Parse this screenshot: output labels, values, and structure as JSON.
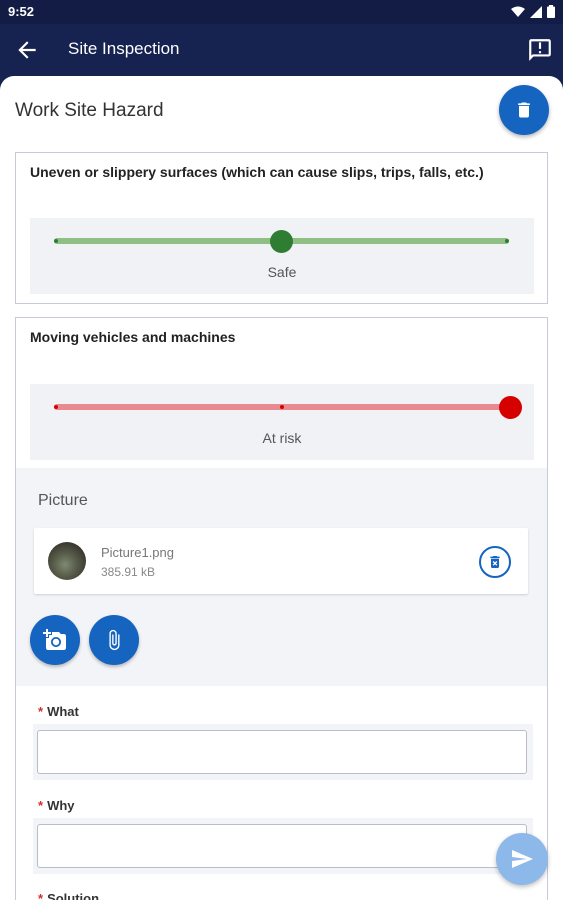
{
  "status_bar": {
    "time": "9:52"
  },
  "app_bar": {
    "title": "Site Inspection"
  },
  "section": {
    "title": "Work Site Hazard"
  },
  "hazards": [
    {
      "label": "Uneven or slippery surfaces (which can cause slips, trips, falls, etc.)",
      "value_label": "Safe",
      "level": 0.5,
      "color": "#8fbf85",
      "thumb_color": "#2e7d32"
    },
    {
      "label": "Moving vehicles and machines",
      "value_label": "At risk",
      "level": 1.0,
      "color": "#e88a8f",
      "thumb_color": "#d50000"
    }
  ],
  "picture": {
    "label": "Picture",
    "file": {
      "name": "Picture1.png",
      "size": "385.91 kB"
    }
  },
  "fields": {
    "what": {
      "label": "What",
      "value": ""
    },
    "why": {
      "label": "Why",
      "value": ""
    },
    "solution": {
      "label": "Solution"
    }
  },
  "colors": {
    "primary": "#1565c0",
    "app_bar": "#16224f",
    "send_fab": "#8db8ea"
  },
  "icons": [
    "back-arrow-icon",
    "feedback-icon",
    "trash-icon",
    "camera-add-icon",
    "paperclip-icon",
    "send-icon"
  ]
}
